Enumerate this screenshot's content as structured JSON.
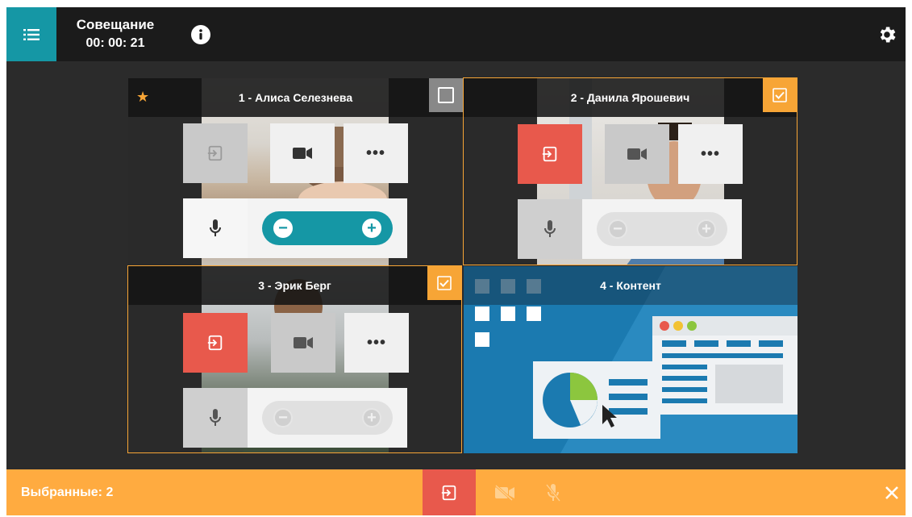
{
  "header": {
    "title": "Совещание",
    "timer": "00: 00: 21"
  },
  "participants": [
    {
      "name": "1 - Алиса Селезнева",
      "is_host": true,
      "selected": false,
      "exit_enabled": false,
      "camera_active": true,
      "mic_active": true,
      "volume_active": true
    },
    {
      "name": "2 - Данила Ярошевич",
      "is_host": false,
      "selected": true,
      "exit_enabled": true,
      "camera_active": false,
      "mic_active": false,
      "volume_active": false
    },
    {
      "name": "3 - Эрик Берг",
      "is_host": false,
      "selected": true,
      "exit_enabled": true,
      "camera_active": false,
      "mic_active": false,
      "volume_active": false
    }
  ],
  "content_tile": {
    "name": "4 - Контент"
  },
  "bottombar": {
    "selected_label": "Выбранные: 2"
  },
  "icons": {
    "menu": "menu-icon",
    "info": "info-icon",
    "settings": "gear-icon",
    "star": "star-icon",
    "exit": "exit-icon",
    "camera": "camera-icon",
    "more": "more-icon",
    "mic": "mic-icon",
    "volume_down": "minus-icon",
    "volume_up": "plus-icon",
    "camera_off": "camera-off-icon",
    "mic_off": "mic-off-icon",
    "close": "close-icon"
  },
  "colors": {
    "accent": "#1597a5",
    "selection": "#f7a536",
    "bottom_bar": "#ffab40",
    "danger": "#e8594c",
    "topbar": "#1b1b1b",
    "stage": "#2b2b2b"
  }
}
